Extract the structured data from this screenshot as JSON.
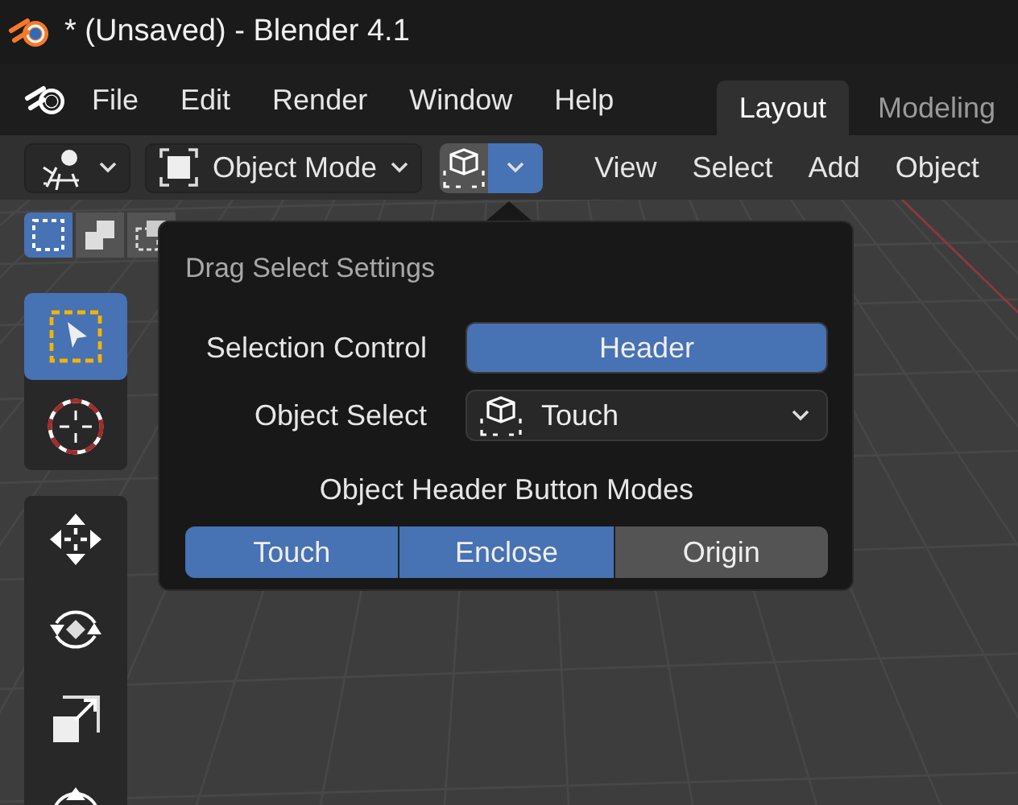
{
  "window": {
    "title": "* (Unsaved) - Blender 4.1"
  },
  "menu": [
    "File",
    "Edit",
    "Render",
    "Window",
    "Help"
  ],
  "workspace_tabs": [
    {
      "label": "Layout",
      "selected": true
    },
    {
      "label": "Modeling",
      "selected": false
    }
  ],
  "header": {
    "mode": "Object Mode",
    "select_button": {
      "expanded": true
    },
    "menus": [
      "View",
      "Select",
      "Add",
      "Object"
    ]
  },
  "select_modes": [
    {
      "kind": "new",
      "selected": true
    },
    {
      "kind": "extend",
      "selected": false
    },
    {
      "kind": "subtract",
      "selected": false
    }
  ],
  "tool_groups": [
    [
      {
        "kind": "select",
        "selected": true
      },
      {
        "kind": "cursor",
        "selected": false
      }
    ],
    [
      {
        "kind": "move",
        "selected": false
      },
      {
        "kind": "rotate",
        "selected": false
      },
      {
        "kind": "scale",
        "selected": false
      },
      {
        "kind": "transform",
        "selected": false
      }
    ]
  ],
  "popup": {
    "title": "Drag Select Settings",
    "selection_control": {
      "label": "Selection Control",
      "value": "Header"
    },
    "object_select": {
      "label": "Object Select",
      "value": "Touch"
    },
    "modes_label": "Object Header Button Modes",
    "modes": [
      {
        "label": "Touch",
        "selected": true
      },
      {
        "label": "Enclose",
        "selected": true
      },
      {
        "label": "Origin",
        "selected": false
      }
    ]
  }
}
